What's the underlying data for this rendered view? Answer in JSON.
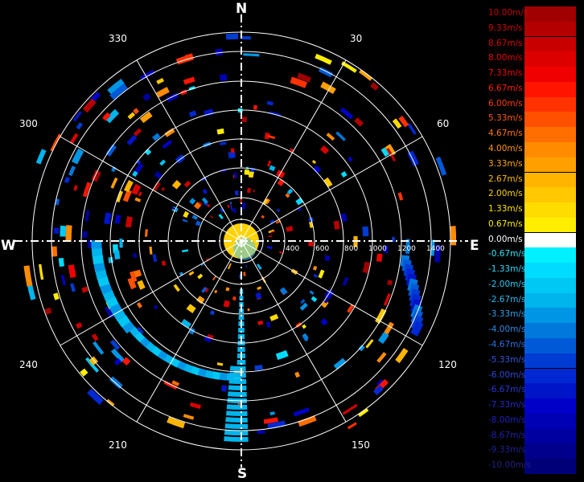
{
  "compass": {
    "north": "N",
    "south": "S",
    "east": "E",
    "west": "W"
  },
  "bearings": [
    "30",
    "60",
    "120",
    "150",
    "210",
    "240",
    "300",
    "330"
  ],
  "range_labels": [
    "400",
    "600",
    "800",
    "1000",
    "1200",
    "1400"
  ],
  "legend": {
    "unit": "m/s",
    "entries": [
      {
        "label": "10.00m/s",
        "color": "#a00000",
        "text_color": "#c80000"
      },
      {
        "label": "9.33m/s",
        "color": "#b40000",
        "text_color": "#d00000"
      },
      {
        "label": "8.67m/s",
        "color": "#c80000",
        "text_color": "#dc0000"
      },
      {
        "label": "8.00m/s",
        "color": "#dc0000",
        "text_color": "#e80000"
      },
      {
        "label": "7.33m/s",
        "color": "#f00000",
        "text_color": "#f20000"
      },
      {
        "label": "6.67m/s",
        "color": "#ff1400",
        "text_color": "#ff1e00"
      },
      {
        "label": "6.00m/s",
        "color": "#ff3200",
        "text_color": "#ff3c00"
      },
      {
        "label": "5.33m/s",
        "color": "#ff5000",
        "text_color": "#ff5a00"
      },
      {
        "label": "4.67m/s",
        "color": "#ff6e00",
        "text_color": "#ff7800"
      },
      {
        "label": "4.00m/s",
        "color": "#ff8c00",
        "text_color": "#ff9600"
      },
      {
        "label": "3.33m/s",
        "color": "#ffa000",
        "text_color": "#ffaa00"
      },
      {
        "label": "2.67m/s",
        "color": "#ffb400",
        "text_color": "#ffbe00"
      },
      {
        "label": "2.00m/s",
        "color": "#ffc800",
        "text_color": "#ffd200"
      },
      {
        "label": "1.33m/s",
        "color": "#ffdc00",
        "text_color": "#ffe100"
      },
      {
        "label": "0.67m/s",
        "color": "#ffee00",
        "text_color": "#ffee00"
      },
      {
        "label": "0.00m/s",
        "color": "#ffffff",
        "text_color": "#ffffff"
      },
      {
        "label": "-0.67m/s",
        "color": "#00f0ff",
        "text_color": "#30e8ff"
      },
      {
        "label": "-1.33m/s",
        "color": "#00dcff",
        "text_color": "#30d8ff"
      },
      {
        "label": "-2.00m/s",
        "color": "#00c8f5",
        "text_color": "#30c8f5"
      },
      {
        "label": "-2.67m/s",
        "color": "#00b4ec",
        "text_color": "#30b8f0"
      },
      {
        "label": "-3.33m/s",
        "color": "#0096e6",
        "text_color": "#30a0ea"
      },
      {
        "label": "-4.00m/s",
        "color": "#0078dc",
        "text_color": "#3088e4"
      },
      {
        "label": "-4.67m/s",
        "color": "#005ad7",
        "text_color": "#3070e0"
      },
      {
        "label": "-5.33m/s",
        "color": "#003cd2",
        "text_color": "#3058dc"
      },
      {
        "label": "-6.00m/s",
        "color": "#0028d2",
        "text_color": "#3048d8"
      },
      {
        "label": "-6.67m/s",
        "color": "#0014c8",
        "text_color": "#2838d0"
      },
      {
        "label": "-7.33m/s",
        "color": "#0000c8",
        "text_color": "#2828c8"
      },
      {
        "label": "-8.00m/s",
        "color": "#0000b4",
        "text_color": "#2020b8"
      },
      {
        "label": "-8.67m/s",
        "color": "#0000a0",
        "text_color": "#2020a8"
      },
      {
        "label": "-9.33m/s",
        "color": "#00008c",
        "text_color": "#202098"
      },
      {
        "label": "-10.00m/s",
        "color": "#000078",
        "text_color": "#202088"
      }
    ]
  }
}
